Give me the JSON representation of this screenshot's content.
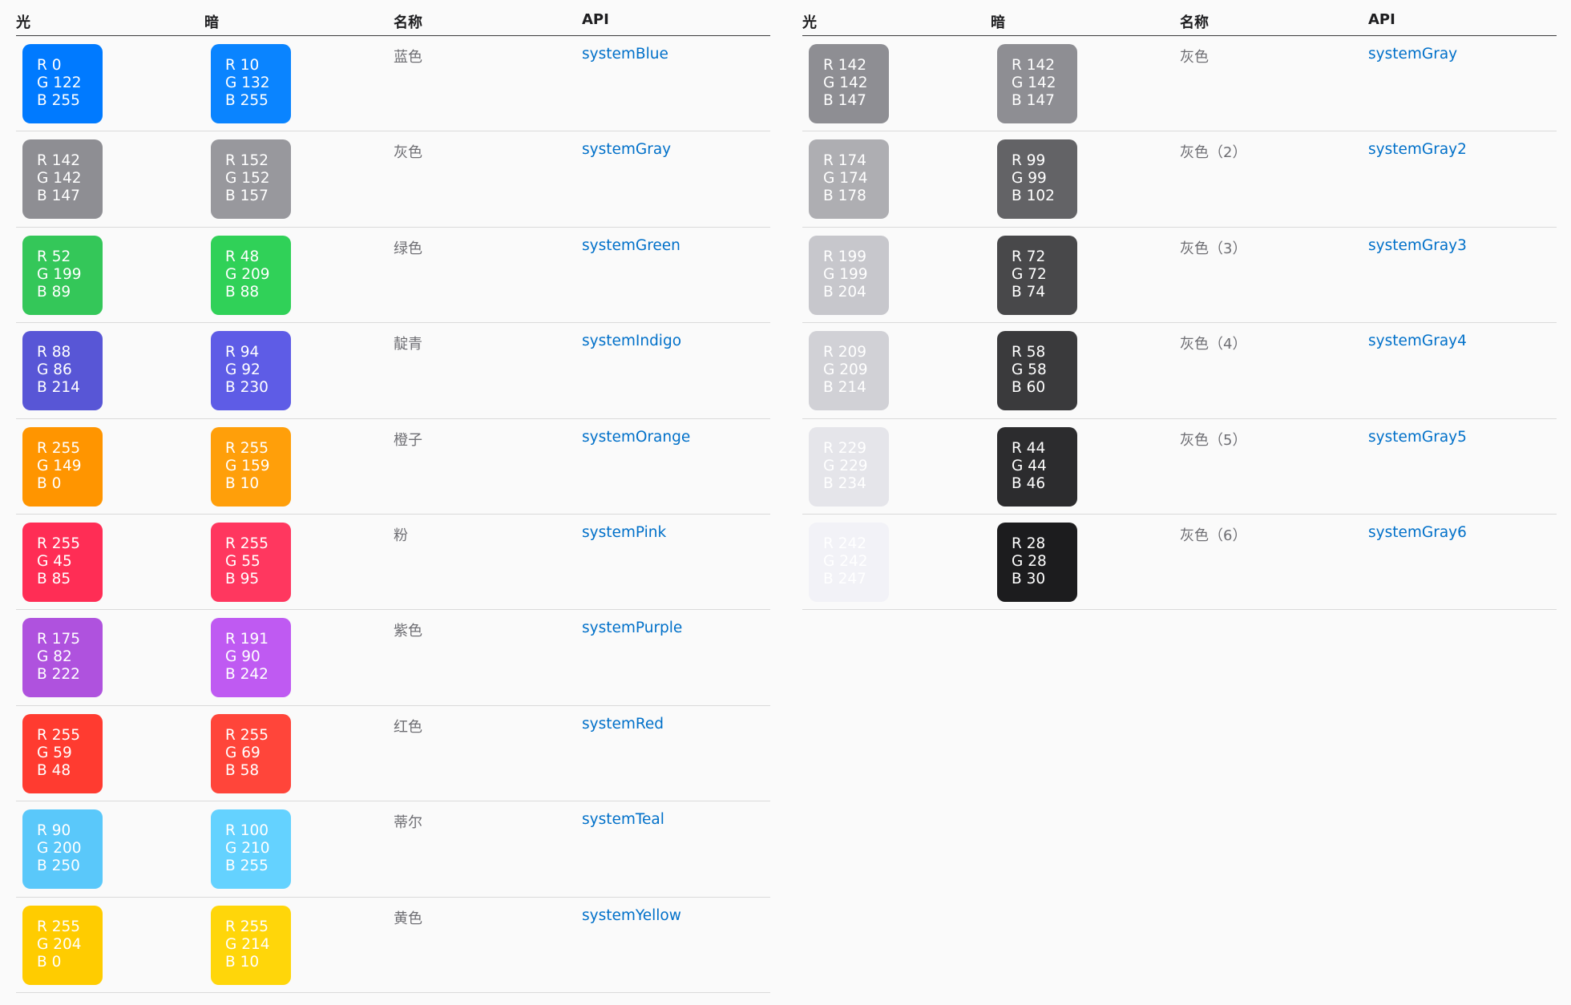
{
  "headers": {
    "light": "光",
    "dark": "暗",
    "name": "名称",
    "api": "API"
  },
  "left_rows": [
    {
      "name": "蓝色",
      "api": "systemBlue",
      "light": {
        "bg": "#007aff",
        "fg": "#ffffff",
        "r": "R 0",
        "g": "G 122",
        "b": "B 255"
      },
      "dark": {
        "bg": "#0a84ff",
        "fg": "#ffffff",
        "r": "R 10",
        "g": "G 132",
        "b": "B 255"
      }
    },
    {
      "name": "灰色",
      "api": "systemGray",
      "light": {
        "bg": "#8e8e93",
        "fg": "#ffffff",
        "r": "R 142",
        "g": "G 142",
        "b": "B 147"
      },
      "dark": {
        "bg": "#98989d",
        "fg": "#ffffff",
        "r": "R 152",
        "g": "G 152",
        "b": "B 157"
      }
    },
    {
      "name": "绿色",
      "api": "systemGreen",
      "light": {
        "bg": "#34c759",
        "fg": "#ffffff",
        "r": "R 52",
        "g": "G 199",
        "b": "B 89"
      },
      "dark": {
        "bg": "#30d158",
        "fg": "#ffffff",
        "r": "R 48",
        "g": "G 209",
        "b": "B 88"
      }
    },
    {
      "name": "靛青",
      "api": "systemIndigo",
      "light": {
        "bg": "#5856d6",
        "fg": "#ffffff",
        "r": "R 88",
        "g": "G 86",
        "b": "B 214"
      },
      "dark": {
        "bg": "#5e5ce6",
        "fg": "#ffffff",
        "r": "R 94",
        "g": "G 92",
        "b": "B 230"
      }
    },
    {
      "name": "橙子",
      "api": "systemOrange",
      "light": {
        "bg": "#ff9500",
        "fg": "#ffffff",
        "r": "R 255",
        "g": "G 149",
        "b": "B 0"
      },
      "dark": {
        "bg": "#ff9f0a",
        "fg": "#ffffff",
        "r": "R 255",
        "g": "G 159",
        "b": "B 10"
      }
    },
    {
      "name": "粉",
      "api": "systemPink",
      "light": {
        "bg": "#ff2d55",
        "fg": "#ffffff",
        "r": "R 255",
        "g": "G 45",
        "b": "B 85"
      },
      "dark": {
        "bg": "#ff375f",
        "fg": "#ffffff",
        "r": "R 255",
        "g": "G 55",
        "b": "B 95"
      }
    },
    {
      "name": "紫色",
      "api": "systemPurple",
      "light": {
        "bg": "#af52de",
        "fg": "#ffffff",
        "r": "R 175",
        "g": "G 82",
        "b": "B 222"
      },
      "dark": {
        "bg": "#bf5af2",
        "fg": "#ffffff",
        "r": "R 191",
        "g": "G 90",
        "b": "B 242"
      }
    },
    {
      "name": "红色",
      "api": "systemRed",
      "light": {
        "bg": "#ff3b30",
        "fg": "#ffffff",
        "r": "R 255",
        "g": "G 59",
        "b": "B 48"
      },
      "dark": {
        "bg": "#ff453a",
        "fg": "#ffffff",
        "r": "R 255",
        "g": "G 69",
        "b": "B 58"
      }
    },
    {
      "name": "蒂尔",
      "api": "systemTeal",
      "light": {
        "bg": "#5ac8fa",
        "fg": "#ffffff",
        "r": "R 90",
        "g": "G 200",
        "b": "B 250"
      },
      "dark": {
        "bg": "#64d2ff",
        "fg": "#ffffff",
        "r": "R 100",
        "g": "G 210",
        "b": "B 255"
      }
    },
    {
      "name": "黄色",
      "api": "systemYellow",
      "light": {
        "bg": "#ffcc00",
        "fg": "#ffffff",
        "r": "R 255",
        "g": "G 204",
        "b": "B 0"
      },
      "dark": {
        "bg": "#ffd60a",
        "fg": "#ffffff",
        "r": "R 255",
        "g": "G 214",
        "b": "B 10"
      }
    }
  ],
  "right_rows": [
    {
      "name": "灰色",
      "api": "systemGray",
      "light": {
        "bg": "#8e8e93",
        "fg": "#ffffff",
        "r": "R 142",
        "g": "G 142",
        "b": "B 147"
      },
      "dark": {
        "bg": "#8e8e93",
        "fg": "#ffffff",
        "r": "R 142",
        "g": "G 142",
        "b": "B 147"
      }
    },
    {
      "name": "灰色（2）",
      "api": "systemGray2",
      "light": {
        "bg": "#aeaeb2",
        "fg": "#ffffff",
        "r": "R 174",
        "g": "G 174",
        "b": "B 178"
      },
      "dark": {
        "bg": "#636366",
        "fg": "#ffffff",
        "r": "R 99",
        "g": "G 99",
        "b": "B 102"
      }
    },
    {
      "name": "灰色（3）",
      "api": "systemGray3",
      "light": {
        "bg": "#c7c7cc",
        "fg": "#ffffff",
        "r": "R 199",
        "g": "G 199",
        "b": "B 204"
      },
      "dark": {
        "bg": "#48484a",
        "fg": "#ffffff",
        "r": "R 72",
        "g": "G 72",
        "b": "B 74"
      }
    },
    {
      "name": "灰色（4）",
      "api": "systemGray4",
      "light": {
        "bg": "#d1d1d6",
        "fg": "#ffffff",
        "r": "R 209",
        "g": "G 209",
        "b": "B 214"
      },
      "dark": {
        "bg": "#3a3a3c",
        "fg": "#ffffff",
        "r": "R 58",
        "g": "G 58",
        "b": "B 60"
      }
    },
    {
      "name": "灰色（5）",
      "api": "systemGray5",
      "light": {
        "bg": "#e5e5ea",
        "fg": "#ffffff",
        "r": "R 229",
        "g": "G 229",
        "b": "B 234"
      },
      "dark": {
        "bg": "#2c2c2e",
        "fg": "#ffffff",
        "r": "R 44",
        "g": "G 44",
        "b": "B 46"
      }
    },
    {
      "name": "灰色（6）",
      "api": "systemGray6",
      "light": {
        "bg": "#f2f2f7",
        "fg": "#ffffff",
        "r": "R 242",
        "g": "G 242",
        "b": "B 247"
      },
      "dark": {
        "bg": "#1c1c1e",
        "fg": "#ffffff",
        "r": "R 28",
        "g": "G 28",
        "b": "B 30"
      }
    }
  ]
}
